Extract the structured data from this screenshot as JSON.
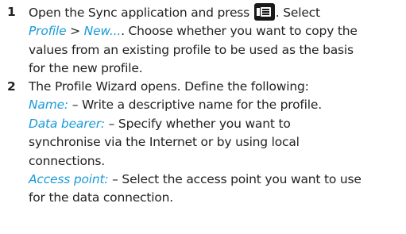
{
  "steps": [
    {
      "number": "1",
      "line1_pre": "Open the Sync application and press",
      "line1_post": ". Select",
      "key_icon": "menu-key-icon",
      "line2_link1": "Profile",
      "line2_sep": " > ",
      "line2_link2": "New...",
      "line2_post": ". Choose whether you want to copy the",
      "line3": "values from an existing profile to be used as the basis",
      "line4": "for the new profile."
    },
    {
      "number": "2",
      "intro": "The Profile Wizard opens. Define the following:",
      "fields": [
        {
          "label": "Name:",
          "lines": [
            "– Write a descriptive name for the profile."
          ]
        },
        {
          "label": "Data bearer:",
          "lines": [
            "– Specify whether you want to",
            "synchronise via the Internet or by using local",
            "connections."
          ]
        },
        {
          "label": "Access point:",
          "lines": [
            "– Select the access point you want to use",
            "for the data connection."
          ]
        }
      ]
    }
  ],
  "colors": {
    "link": "#1a9bd8",
    "text": "#222222"
  }
}
